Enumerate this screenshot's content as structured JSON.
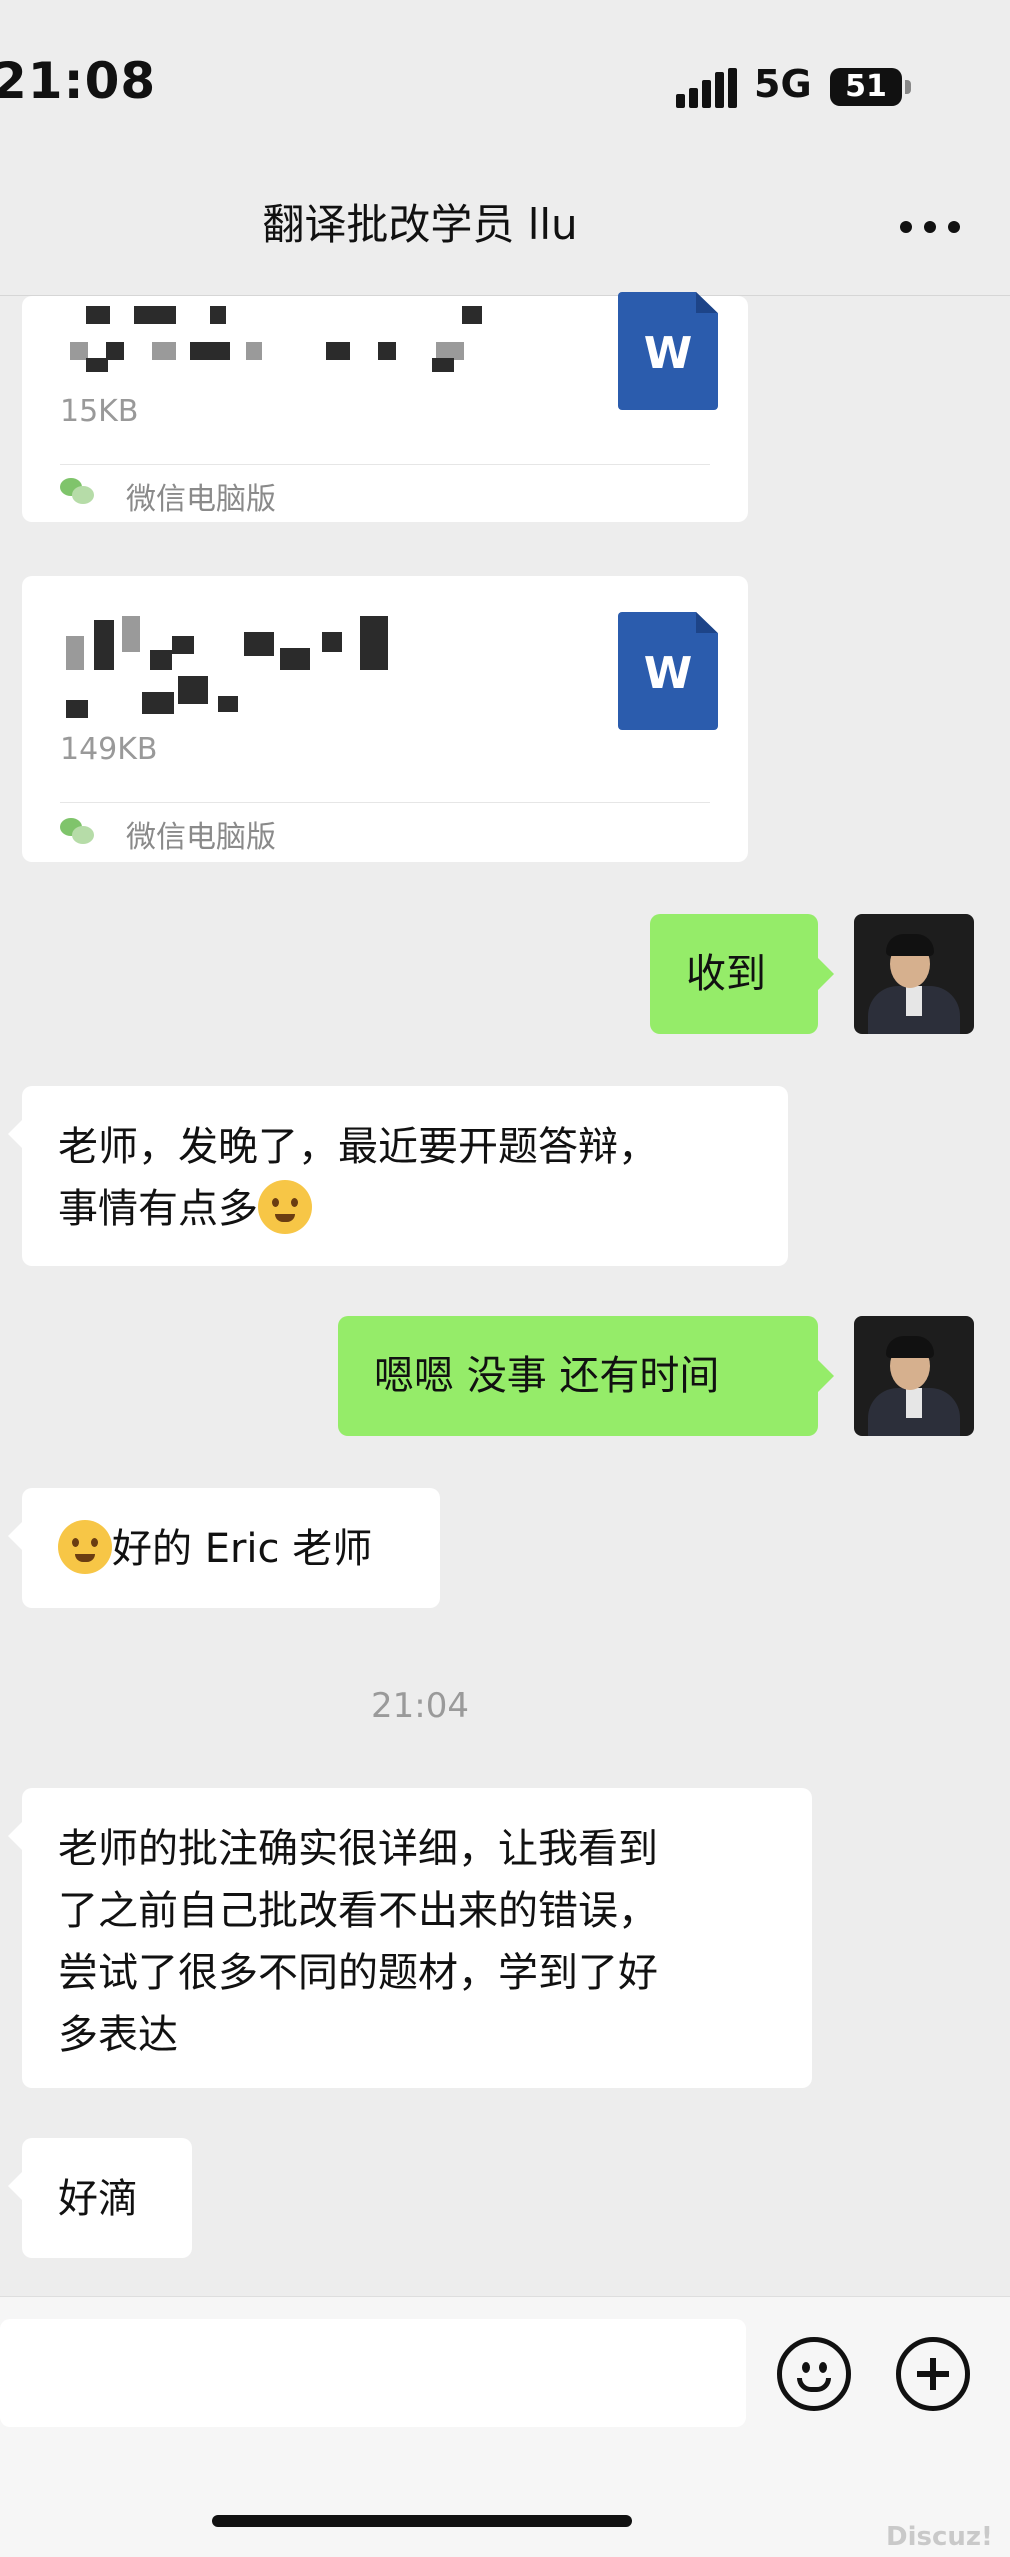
{
  "status_bar": {
    "time": "21:08",
    "network": "5G",
    "battery": "51"
  },
  "header": {
    "title": "翻译批改学员 llu"
  },
  "files": [
    {
      "size": "15KB",
      "source": "微信电脑版",
      "file_type_icon": "W"
    },
    {
      "size": "149KB",
      "source": "微信电脑版",
      "file_type_icon": "W"
    }
  ],
  "messages": {
    "m1": "收到",
    "m2_line1": "老师，发晚了，最近要开题答辩，",
    "m2_line2": "事情有点多",
    "m3": "嗯嗯 没事 还有时间",
    "m4": "好的 Eric 老师",
    "timestamp": "21:04",
    "m5_line1": "老师的批注确实很详细，让我看到",
    "m5_line2": "了之前自己批改看不出来的错误，",
    "m5_line3": "尝试了很多不同的题材，学到了好",
    "m5_line4": "多表达",
    "m6": "好滴"
  },
  "watermark": "Discuz!",
  "colors": {
    "background": "#ededed",
    "bubble_self": "#95ec69",
    "bubble_other": "#ffffff",
    "word_icon": "#2b5cad"
  }
}
